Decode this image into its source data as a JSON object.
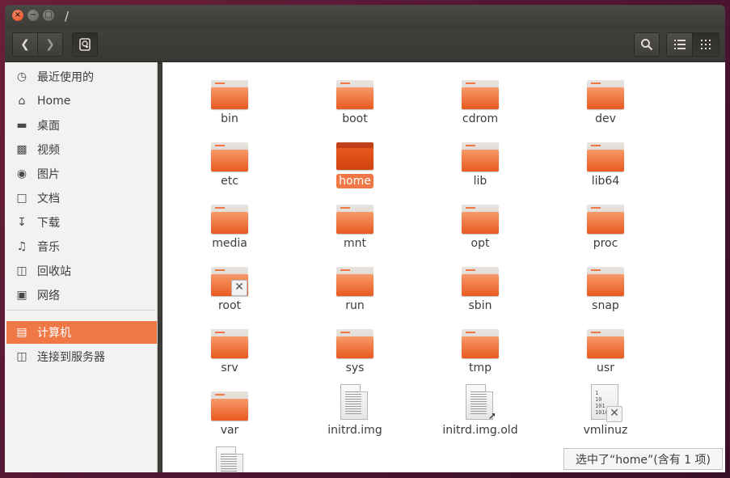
{
  "window": {
    "title": "/"
  },
  "sidebar": {
    "items": [
      {
        "label": "最近使用的",
        "icon": "clock-icon"
      },
      {
        "label": "Home",
        "icon": "home-icon"
      },
      {
        "label": "桌面",
        "icon": "desktop-folder-icon"
      },
      {
        "label": "视频",
        "icon": "video-icon"
      },
      {
        "label": "图片",
        "icon": "camera-icon"
      },
      {
        "label": "文档",
        "icon": "document-icon"
      },
      {
        "label": "下载",
        "icon": "download-icon"
      },
      {
        "label": "音乐",
        "icon": "music-icon"
      },
      {
        "label": "回收站",
        "icon": "trash-icon"
      },
      {
        "label": "网络",
        "icon": "network-icon"
      },
      {
        "label": "计算机",
        "icon": "computer-icon",
        "selected": true
      },
      {
        "label": "连接到服务器",
        "icon": "server-icon"
      }
    ]
  },
  "files": [
    {
      "name": "bin"
    },
    {
      "name": "boot"
    },
    {
      "name": "cdrom"
    },
    {
      "name": "dev"
    },
    {
      "name": "etc"
    },
    {
      "name": "home"
    },
    {
      "name": "lib"
    },
    {
      "name": "lib64"
    },
    {
      "name": "media"
    },
    {
      "name": "mnt"
    },
    {
      "name": "opt"
    },
    {
      "name": "proc"
    },
    {
      "name": "root"
    },
    {
      "name": "run"
    },
    {
      "name": "sbin"
    },
    {
      "name": "snap"
    },
    {
      "name": "srv"
    },
    {
      "name": "sys"
    },
    {
      "name": "tmp"
    },
    {
      "name": "usr"
    },
    {
      "name": "var"
    },
    {
      "name": "initrd.img"
    },
    {
      "name": "initrd.img.old"
    },
    {
      "name": "vmlinuz"
    }
  ],
  "vmlinuz_binary": "1\n10\n101\n1010",
  "status": {
    "text": "选中了“home”(含有 1 项)"
  },
  "colors": {
    "accent": "#f07746",
    "titlebar": "#3c3b37",
    "sidebar_bg": "#f3f2f1"
  }
}
